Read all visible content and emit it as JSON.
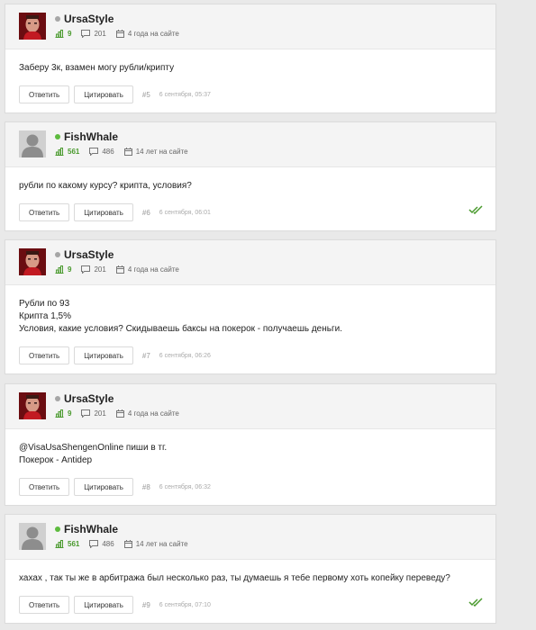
{
  "colors": {
    "online": "#5dbb3e",
    "offline": "#a6a6a6",
    "rating": "#4a9a2e",
    "accept": "#4a9a2e"
  },
  "posts": [
    {
      "user": "UrsaStyle",
      "status": "offline",
      "rating": "9",
      "messages": "201",
      "on_site": "4 года на сайте",
      "body": [
        "Заберу 3к, взамен могу рубли/крипту"
      ],
      "reply_label": "Ответить",
      "quote_label": "Цитировать",
      "num": "#5",
      "date": "6 сентября, 05:37",
      "accepted": false
    },
    {
      "user": "FishWhale",
      "status": "online",
      "rating": "561",
      "messages": "486",
      "on_site": "14 лет на сайте",
      "body": [
        "рубли по какому курсу? крипта, условия?"
      ],
      "reply_label": "Ответить",
      "quote_label": "Цитировать",
      "num": "#6",
      "date": "6 сентября, 06:01",
      "accepted": true
    },
    {
      "user": "UrsaStyle",
      "status": "offline",
      "rating": "9",
      "messages": "201",
      "on_site": "4 года на сайте",
      "body": [
        "Рубли по 93",
        "Крипта 1,5%",
        "Условия, какие условия? Скидываешь баксы на покерок - получаешь деньги."
      ],
      "reply_label": "Ответить",
      "quote_label": "Цитировать",
      "num": "#7",
      "date": "6 сентября, 06:26",
      "accepted": false
    },
    {
      "user": "UrsaStyle",
      "status": "offline",
      "rating": "9",
      "messages": "201",
      "on_site": "4 года на сайте",
      "body": [
        "@VisaUsaShengenOnline пиши в тг.",
        "Покерок - Antidep"
      ],
      "reply_label": "Ответить",
      "quote_label": "Цитировать",
      "num": "#8",
      "date": "6 сентября, 06:32",
      "accepted": false
    },
    {
      "user": "FishWhale",
      "status": "online",
      "rating": "561",
      "messages": "486",
      "on_site": "14 лет на сайте",
      "body": [
        "хахах , так ты же в арбитража был несколько раз, ты думаешь я тебе первому хоть копейку переведу?"
      ],
      "reply_label": "Ответить",
      "quote_label": "Цитировать",
      "num": "#9",
      "date": "6 сентября, 07:10",
      "accepted": true
    }
  ]
}
